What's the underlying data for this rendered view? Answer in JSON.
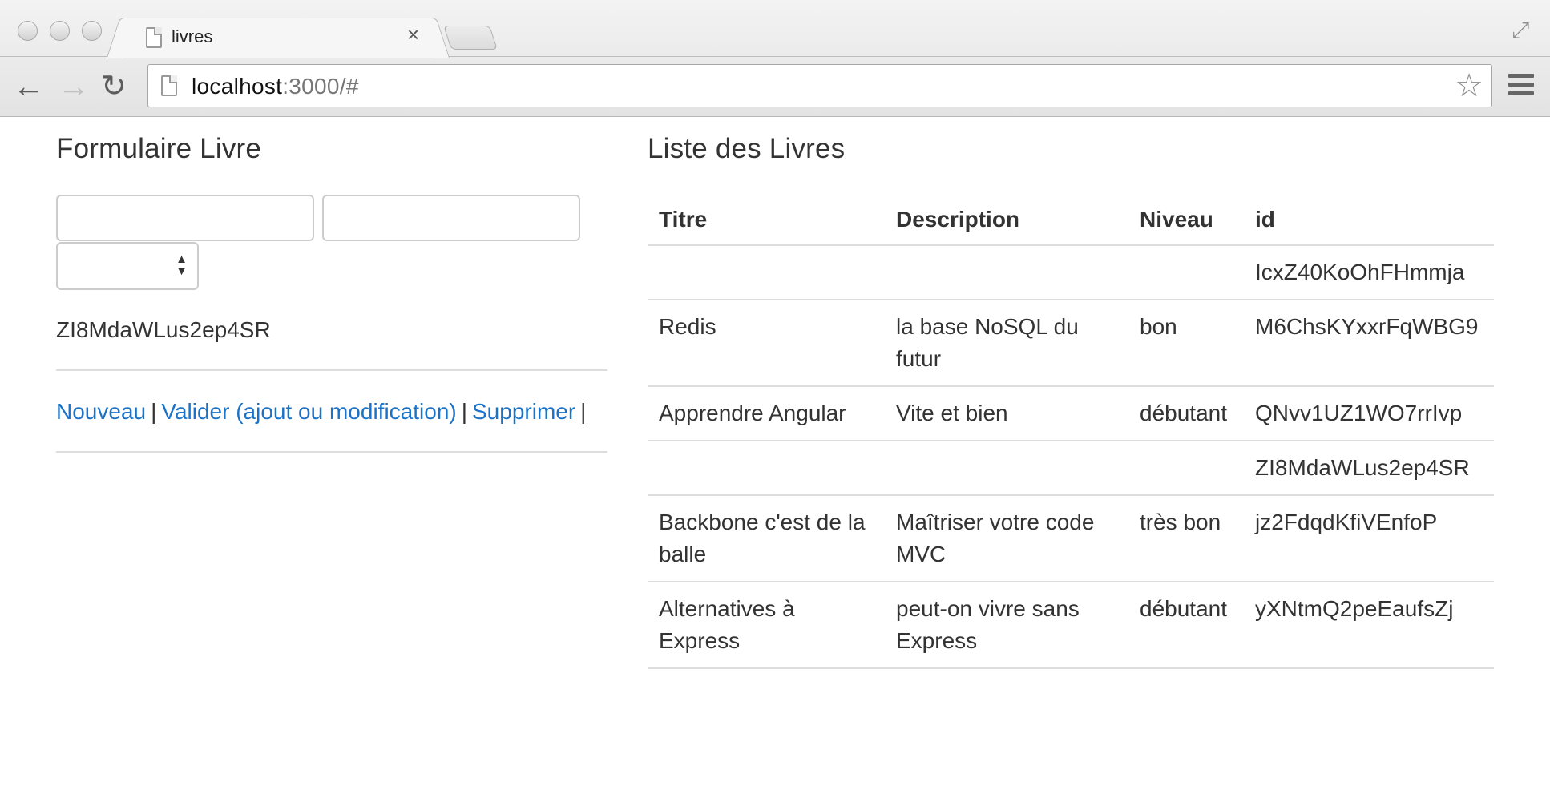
{
  "browser": {
    "tab_title": "livres",
    "url_host": "localhost",
    "url_rest": ":3000/#"
  },
  "form": {
    "title": "Formulaire Livre",
    "titre_value": "",
    "description_value": "",
    "niveau_value": "",
    "current_id": "ZI8MdaWLus2ep4SR",
    "actions": {
      "nouveau": "Nouveau",
      "valider": "Valider (ajout ou modification)",
      "supprimer": "Supprimer",
      "separator": "|"
    }
  },
  "list": {
    "title": "Liste des Livres",
    "columns": [
      "Titre",
      "Description",
      "Niveau",
      "id"
    ],
    "rows": [
      {
        "titre": "",
        "description": "",
        "niveau": "",
        "id": "IcxZ40KoOhFHmmja"
      },
      {
        "titre": "Redis",
        "description": "la base NoSQL du futur",
        "niveau": "bon",
        "id": "M6ChsKYxxrFqWBG9"
      },
      {
        "titre": "Apprendre Angular",
        "description": "Vite et bien",
        "niveau": "débutant",
        "id": "QNvv1UZ1WO7rrIvp"
      },
      {
        "titre": "",
        "description": "",
        "niveau": "",
        "id": "ZI8MdaWLus2ep4SR"
      },
      {
        "titre": "Backbone c'est de la balle",
        "description": "Maîtriser votre code MVC",
        "niveau": "très bon",
        "id": "jz2FdqdKfiVEnfoP"
      },
      {
        "titre": "Alternatives à Express",
        "description": "peut-on vivre sans Express",
        "niveau": "débutant",
        "id": "yXNtmQ2peEaufsZj"
      }
    ]
  },
  "colors": {
    "link": "#1a73c8",
    "text": "#333333",
    "border": "#dddddd"
  }
}
